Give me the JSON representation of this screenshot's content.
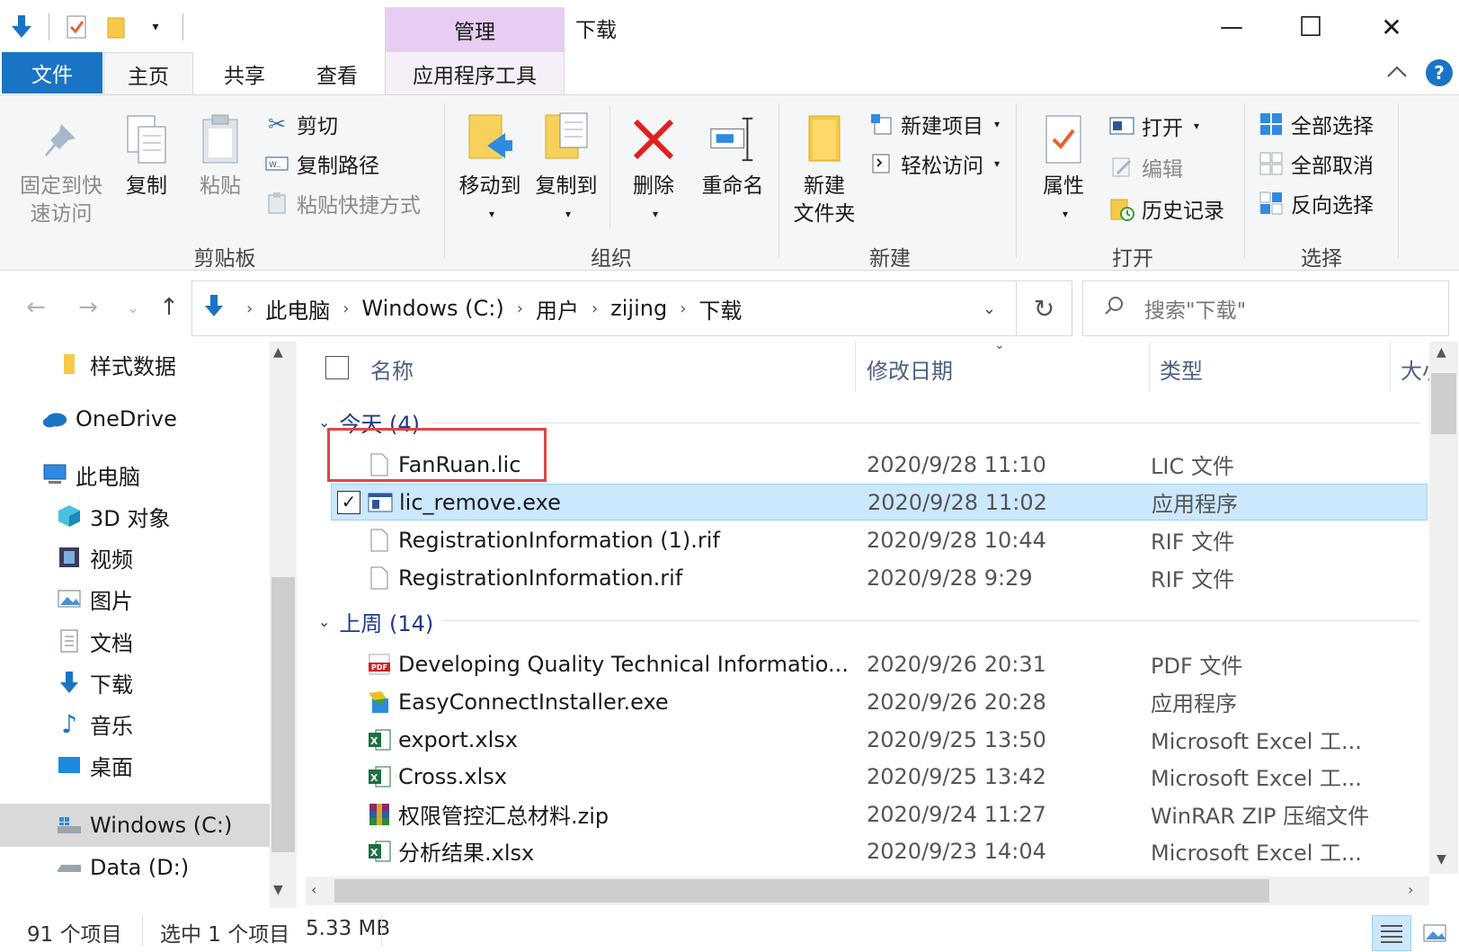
{
  "window": {
    "title": "下载",
    "context_tab_group": "管理",
    "minimize_label": "—",
    "maximize_label": "☐",
    "close_label": "✕",
    "help_label": "?"
  },
  "tabs": {
    "file": "文件",
    "home": "主页",
    "share": "共享",
    "view": "查看",
    "apptools": "应用程序工具"
  },
  "ribbon": {
    "clipboard": {
      "label": "剪贴板",
      "pin": "固定到快速访问",
      "pin_line1": "固定到快",
      "pin_line2": "速访问",
      "copy": "复制",
      "paste": "粘贴",
      "cut": "剪切",
      "copy_path": "复制路径",
      "paste_shortcut": "粘贴快捷方式"
    },
    "organize": {
      "label": "组织",
      "move_to": "移动到",
      "copy_to": "复制到",
      "delete": "删除",
      "rename": "重命名"
    },
    "new": {
      "label": "新建",
      "new_folder_line1": "新建",
      "new_folder_line2": "文件夹",
      "new_item": "新建项目",
      "easy_access": "轻松访问"
    },
    "open": {
      "label": "打开",
      "properties": "属性",
      "open": "打开",
      "edit": "编辑",
      "history": "历史记录"
    },
    "select": {
      "label": "选择",
      "select_all": "全部选择",
      "select_none": "全部取消",
      "invert": "反向选择"
    }
  },
  "address": {
    "crumbs": [
      "此电脑",
      "Windows (C:)",
      "用户",
      "zijing",
      "下载"
    ],
    "search_placeholder": "搜索\"下载\""
  },
  "nav_pane": {
    "items": [
      {
        "label": "样式数据",
        "icon": "folder-icon"
      },
      {
        "label": "OneDrive",
        "icon": "cloud-icon"
      },
      {
        "label": "此电脑",
        "icon": "computer-icon"
      },
      {
        "label": "3D 对象",
        "icon": "cube-icon"
      },
      {
        "label": "视频",
        "icon": "video-icon"
      },
      {
        "label": "图片",
        "icon": "picture-icon"
      },
      {
        "label": "文档",
        "icon": "document-icon"
      },
      {
        "label": "下载",
        "icon": "download-icon"
      },
      {
        "label": "音乐",
        "icon": "music-icon"
      },
      {
        "label": "桌面",
        "icon": "desktop-icon"
      },
      {
        "label": "Windows (C:)",
        "icon": "drive-c-icon"
      },
      {
        "label": "Data (D:)",
        "icon": "drive-icon"
      }
    ],
    "selected": "Windows (C:)"
  },
  "columns": {
    "name": "名称",
    "modified": "修改日期",
    "type": "类型",
    "size": "大小"
  },
  "groups": [
    {
      "label": "今天 (4)",
      "files": [
        {
          "name": "FanRuan.lic",
          "date": "2020/9/28 11:10",
          "type": "LIC 文件",
          "icon": "file-icon"
        },
        {
          "name": "lic_remove.exe",
          "date": "2020/9/28 11:02",
          "type": "应用程序",
          "icon": "exe-icon",
          "selected": true
        },
        {
          "name": "RegistrationInformation (1).rif",
          "date": "2020/9/28 10:44",
          "type": "RIF 文件",
          "icon": "file-icon"
        },
        {
          "name": "RegistrationInformation.rif",
          "date": "2020/9/28 9:29",
          "type": "RIF 文件",
          "icon": "file-icon"
        }
      ]
    },
    {
      "label": "上周 (14)",
      "files": [
        {
          "name": "Developing Quality Technical Informatio...",
          "date": "2020/9/26 20:31",
          "type": "PDF 文件",
          "icon": "pdf-icon"
        },
        {
          "name": "EasyConnectInstaller.exe",
          "date": "2020/9/26 20:28",
          "type": "应用程序",
          "icon": "installer-icon"
        },
        {
          "name": "export.xlsx",
          "date": "2020/9/25 13:50",
          "type": "Microsoft Excel 工...",
          "icon": "excel-icon"
        },
        {
          "name": "Cross.xlsx",
          "date": "2020/9/25 13:42",
          "type": "Microsoft Excel 工...",
          "icon": "excel-icon"
        },
        {
          "name": "权限管控汇总材料.zip",
          "date": "2020/9/24 11:27",
          "type": "WinRAR ZIP 压缩文件",
          "icon": "winrar-icon"
        },
        {
          "name": "分析结果.xlsx",
          "date": "2020/9/23 14:04",
          "type": "Microsoft Excel 工...",
          "icon": "excel-icon"
        }
      ]
    }
  ],
  "status": {
    "count": "91 个项目",
    "selection": "选中 1 个项目",
    "size": "5.33 MB"
  },
  "colors": {
    "accent": "#1a74c4",
    "context_tab": "#e8cdf2",
    "selection": "#cce8ff",
    "highlight_box": "#e04545"
  }
}
